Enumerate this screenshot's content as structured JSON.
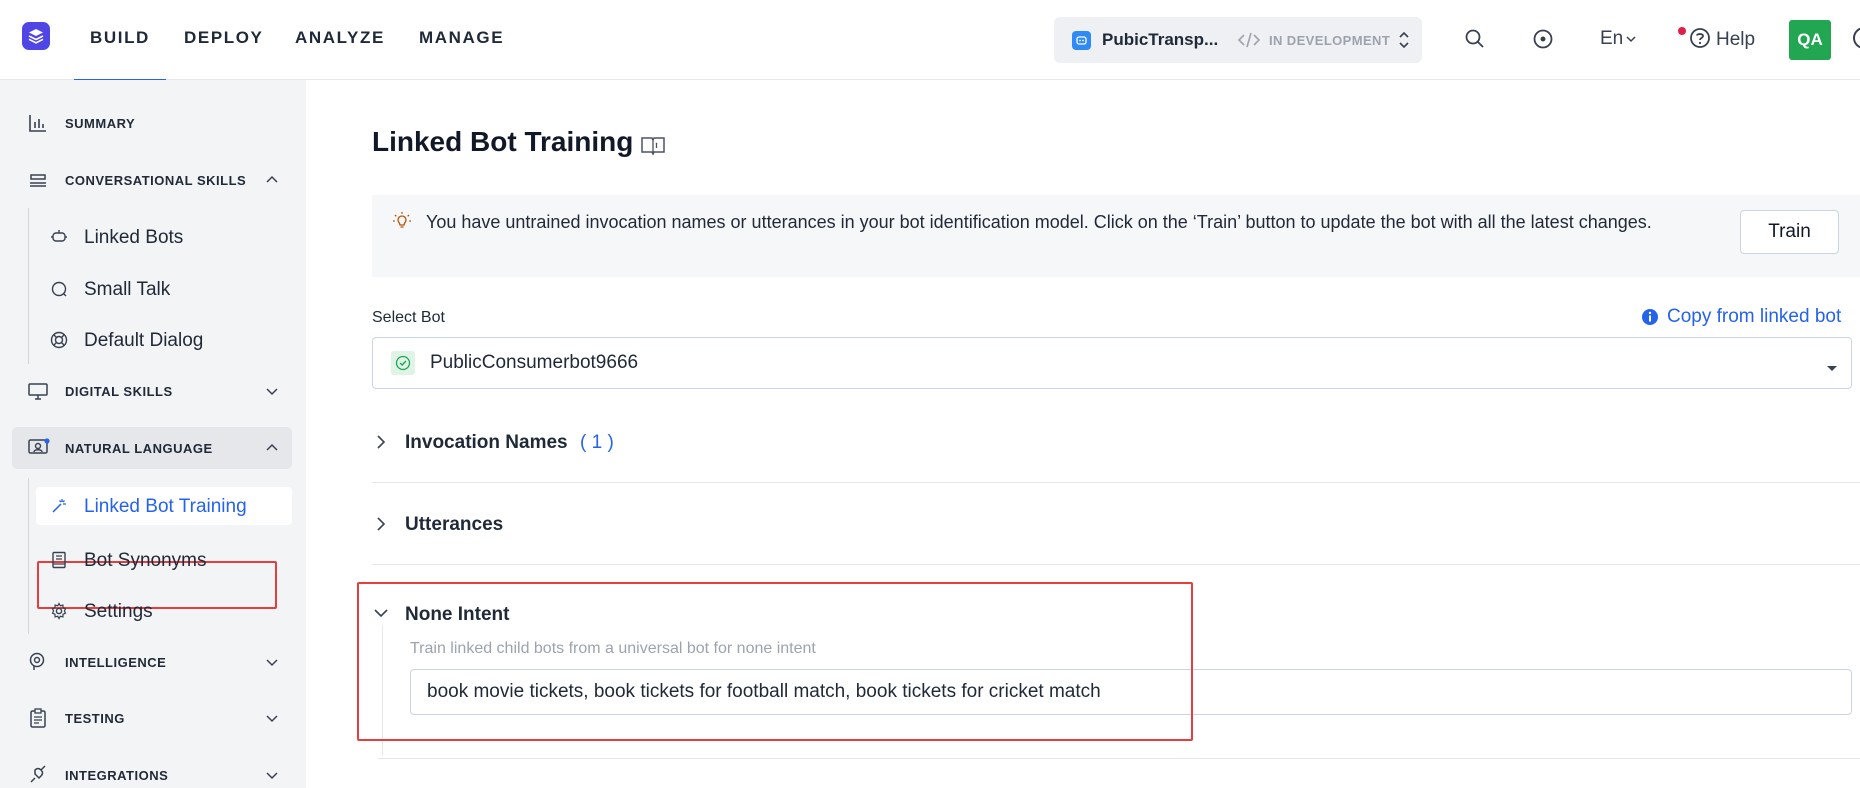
{
  "nav": {
    "tabs": [
      {
        "label": "BUILD",
        "active": true
      },
      {
        "label": "DEPLOY",
        "active": false
      },
      {
        "label": "ANALYZE",
        "active": false
      },
      {
        "label": "MANAGE",
        "active": false
      }
    ]
  },
  "bot_switcher": {
    "name": "PubicTransp...",
    "status": "IN DEVELOPMENT"
  },
  "header": {
    "language": "En",
    "help_label": "Help",
    "avatar_initials": "QA"
  },
  "sidebar": {
    "sections": [
      {
        "label": "SUMMARY",
        "icon": "bar-chart-icon",
        "expanded": null
      },
      {
        "label": "CONVERSATIONAL SKILLS",
        "icon": "stack-icon",
        "expanded": true,
        "items": [
          {
            "label": "Linked Bots",
            "icon": "bot-link-icon"
          },
          {
            "label": "Small Talk",
            "icon": "chat-bubble-icon"
          },
          {
            "label": "Default Dialog",
            "icon": "lifebuoy-icon"
          }
        ]
      },
      {
        "label": "DIGITAL SKILLS",
        "icon": "monitor-icon",
        "expanded": false
      },
      {
        "label": "NATURAL LANGUAGE",
        "icon": "nlp-icon",
        "expanded": true,
        "selected": true,
        "items": [
          {
            "label": "Linked Bot Training",
            "icon": "magic-wand-icon",
            "active": true
          },
          {
            "label": "Bot Synonyms",
            "icon": "book-icon"
          },
          {
            "label": "Settings",
            "icon": "gear-icon"
          }
        ]
      },
      {
        "label": "INTELLIGENCE",
        "icon": "brain-icon",
        "expanded": false
      },
      {
        "label": "TESTING",
        "icon": "clipboard-icon",
        "expanded": false
      },
      {
        "label": "INTEGRATIONS",
        "icon": "plug-icon",
        "expanded": false
      }
    ]
  },
  "main": {
    "title": "Linked Bot Training",
    "banner": {
      "text": "You have untrained invocation names or utterances in your bot identification model. Click on the ‘Train’ button to update the bot with all the latest changes.",
      "button_label": "Train"
    },
    "select_bot": {
      "label": "Select Bot",
      "value": "PublicConsumerbot9666",
      "copy_link_label": "Copy from linked bot"
    },
    "accordions": {
      "invocation": {
        "title": "Invocation Names",
        "count": "( 1 )",
        "expanded": false
      },
      "utterances": {
        "title": "Utterances",
        "expanded": false
      },
      "none_intent": {
        "title": "None Intent",
        "expanded": true,
        "description": "Train linked child bots from a universal bot for none intent",
        "value": "book movie tickets, book tickets for football match, book tickets for cricket match"
      }
    }
  },
  "colors": {
    "accent": "#2563eb",
    "logo": "#4f46e5",
    "avatar": "#22a652",
    "highlight_outline": "#e53e3e"
  }
}
